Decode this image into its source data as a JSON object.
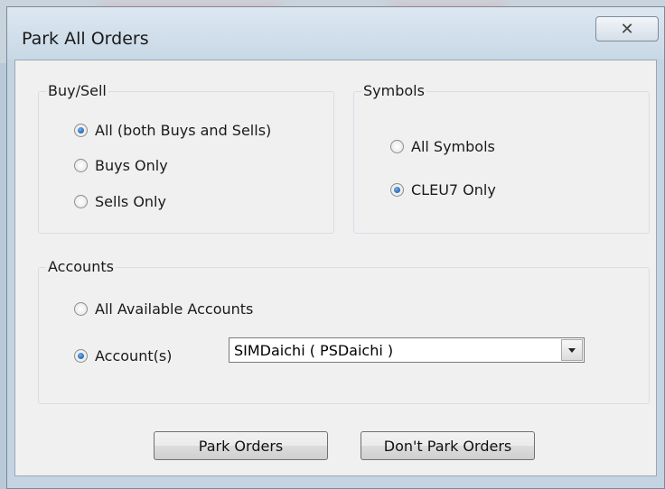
{
  "window": {
    "title": "Park All Orders",
    "close_glyph": "✕"
  },
  "buy_sell": {
    "label": "Buy/Sell",
    "options": [
      {
        "label": "All  (both Buys and Sells)",
        "checked": true
      },
      {
        "label": "Buys Only",
        "checked": false
      },
      {
        "label": "Sells Only",
        "checked": false
      }
    ]
  },
  "symbols": {
    "label": "Symbols",
    "options": [
      {
        "label": "All Symbols",
        "checked": false
      },
      {
        "label": "CLEU7 Only",
        "checked": true
      }
    ]
  },
  "accounts": {
    "label": "Accounts",
    "options": [
      {
        "label": "All Available Accounts",
        "checked": false
      },
      {
        "label": "Account(s)",
        "checked": true
      }
    ],
    "selected_account": "SIMDaichi ( PSDaichi )"
  },
  "buttons": {
    "park": "Park Orders",
    "dont_park": "Don't Park Orders"
  }
}
